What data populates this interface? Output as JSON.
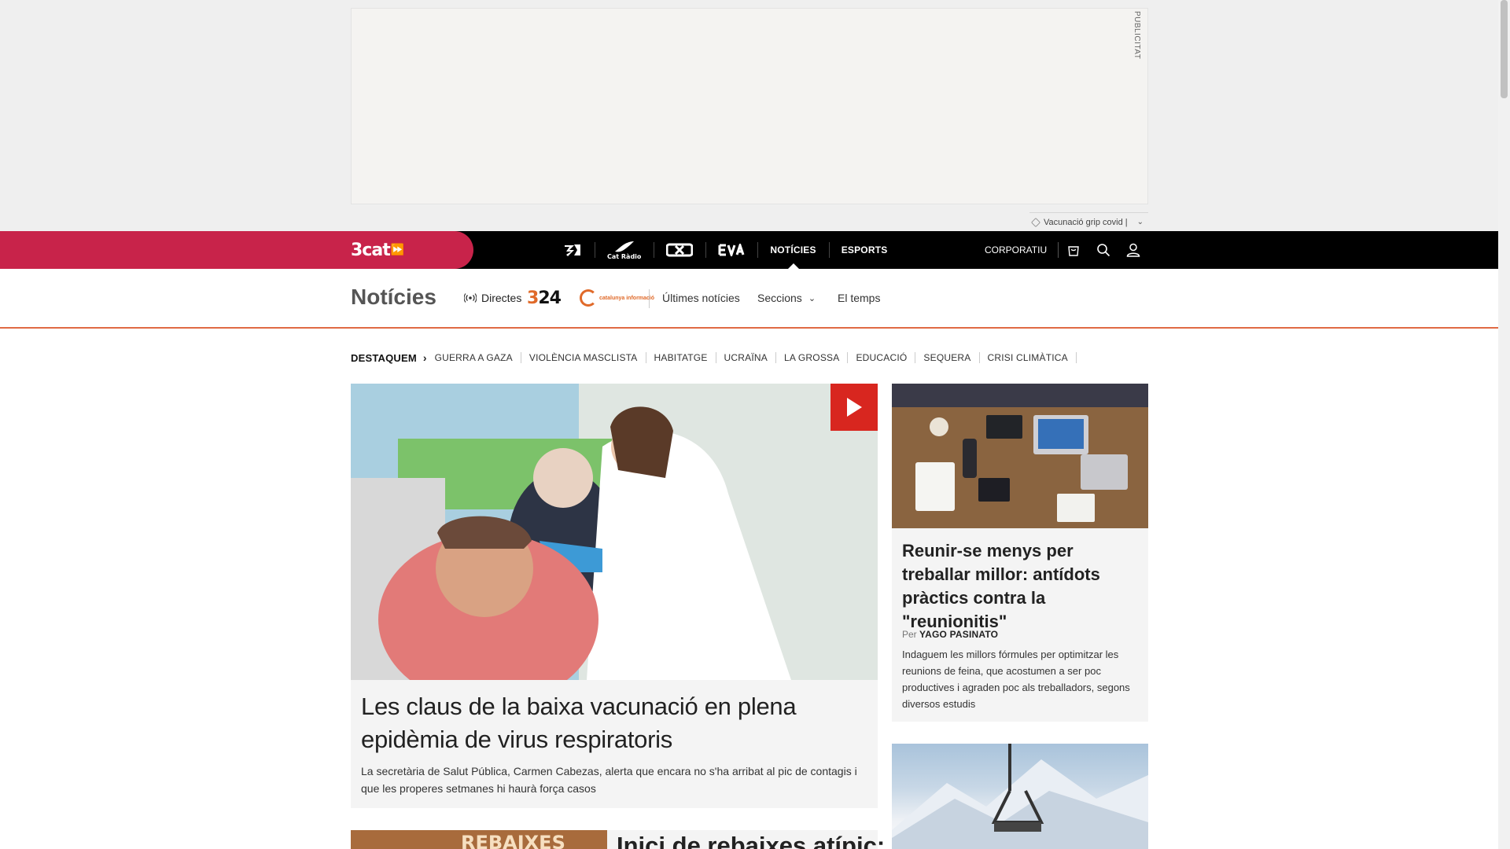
{
  "ad": {
    "label": "PUBLICITAT"
  },
  "hint": {
    "text": "Vacunació grip covid |"
  },
  "nav": {
    "brand": "3cat",
    "channels": [
      {
        "label": "3",
        "icon": "tv3-logo-icon"
      },
      {
        "label": "Cat Ràdio",
        "icon": "catradio-logo-icon"
      },
      {
        "label": "SX3",
        "icon": "sx3-logo-icon"
      },
      {
        "label": "EVA",
        "icon": "eva-logo-icon"
      }
    ],
    "noticies": "NOTÍCIES",
    "esports": "ESPORTS",
    "corporatiu": "CORPORATIU"
  },
  "section": {
    "title": "Notícies",
    "directes": "Directes",
    "logo_324": "324",
    "logo_ci": "catalunya informació",
    "ultimes": "Últimes notícies",
    "seccions": "Seccions",
    "temps": "El temps"
  },
  "destaquem": {
    "label": "DESTAQUEM",
    "items": [
      "GUERRA A GAZA",
      "VIOLÈNCIA MASCLISTA",
      "HABITATGE",
      "UCRAÏNA",
      "LA GROSSA",
      "EDUCACIÓ",
      "SEQUERA",
      "CRISI CLIMÀTICA"
    ]
  },
  "main_story": {
    "title": "Les claus de la baixa vacunació en plena epidèmia de virus respiratoris",
    "subtitle": "La secretària de Salut Pública, Carmen Cabezas, alerta que encara no s'ha arribat al pic de contagis i que les properes setmanes hi haurà força casos"
  },
  "side_story": {
    "title": "Reunir-se menys per treballar millor: antídots pràctics contra la \"reunionitis\"",
    "by_prefix": "Per",
    "author": "YAGO PASINATO",
    "subtitle": "Indaguem les millors fórmules per optimitzar les reunions de feina, que acostumen a ser poc productives i agraden poc als treballadors, segons diversos estudis"
  },
  "lower_story": {
    "title": "Inici de rebaixes atípic:",
    "image_text": "REBAIXES"
  },
  "colors": {
    "brand": "#c8234a",
    "section_accent": "#e06a44",
    "play": "#d8261f"
  }
}
